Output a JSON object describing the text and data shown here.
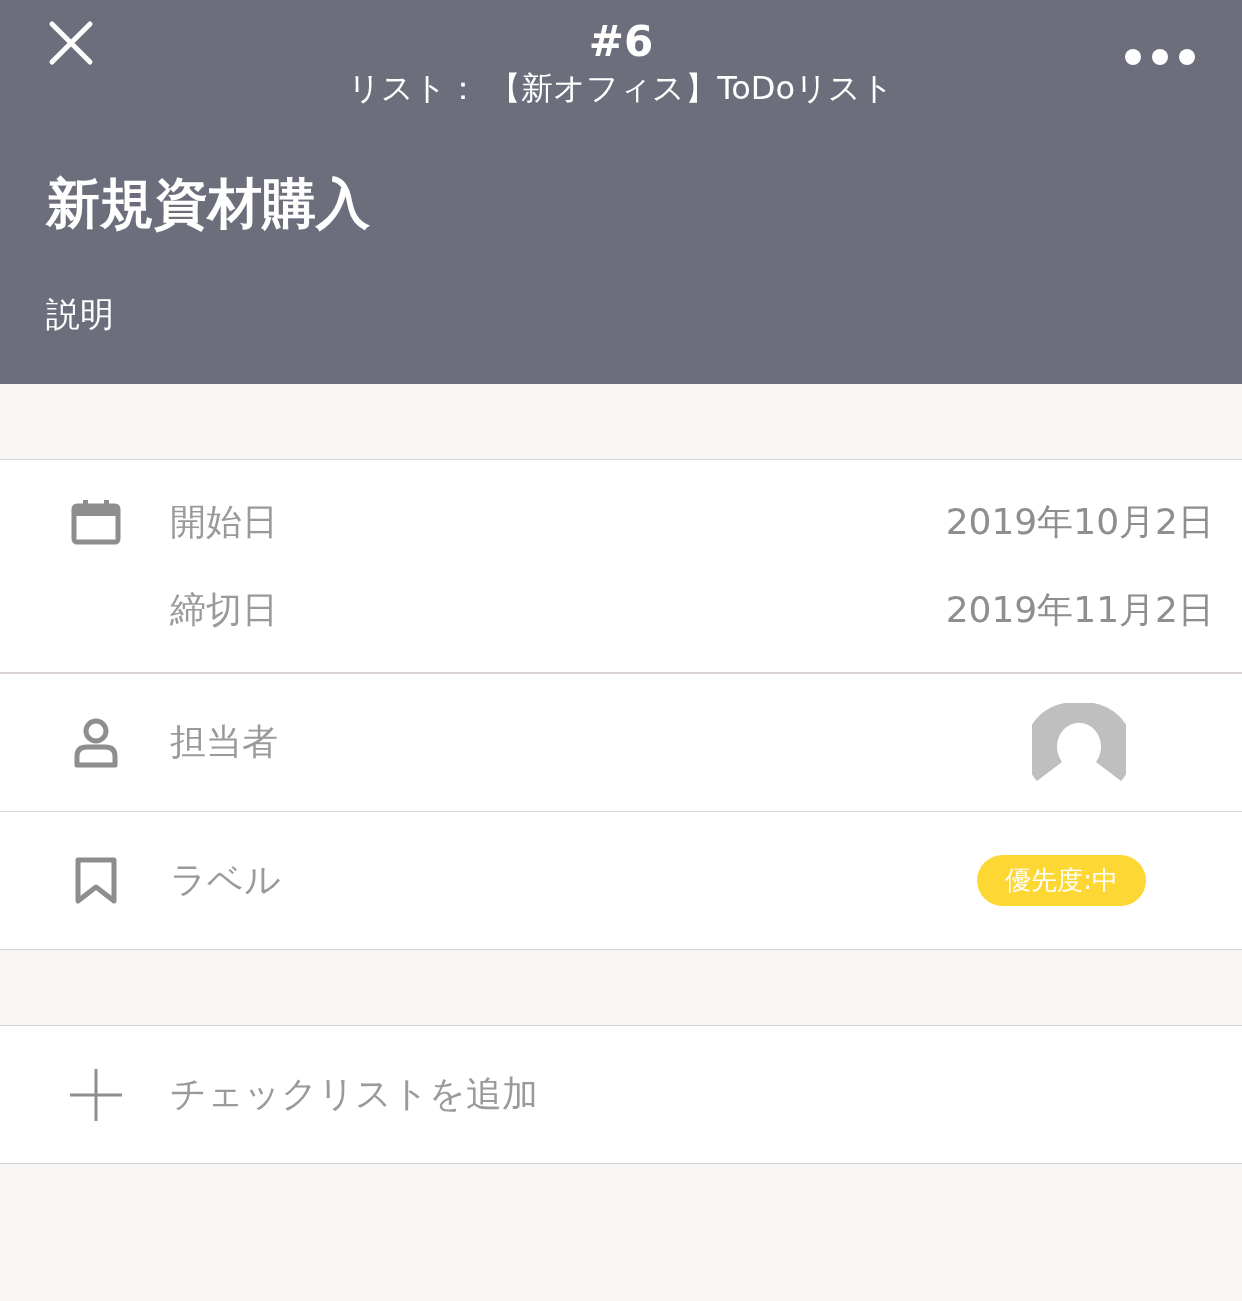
{
  "header": {
    "number": "#6",
    "list": "リスト： 【新オフィス】ToDoリスト",
    "title": "新規資材購入",
    "description": "説明"
  },
  "dates": [
    {
      "label": "開始日",
      "value": "2019年10月2日"
    },
    {
      "label": "締切日",
      "value": "2019年11月2日"
    }
  ],
  "assignee": {
    "label": "担当者"
  },
  "labels": {
    "label": "ラベル",
    "tags": [
      {
        "text": "優先度:中",
        "color": "#fdd835"
      }
    ]
  },
  "checklist": {
    "label": "チェックリストを追加"
  }
}
